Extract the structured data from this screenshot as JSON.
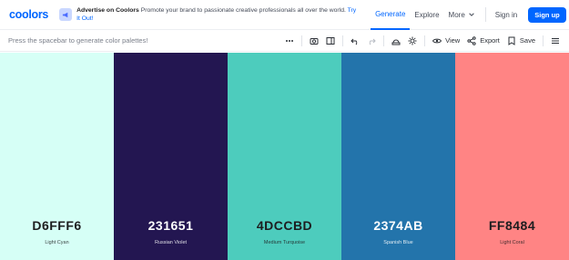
{
  "header": {
    "logo": "coolors",
    "ad": {
      "title": "Advertise on Coolors",
      "text": "Promote your brand to passionate creative professionals all over the world.",
      "cta": "Try It Out!"
    },
    "nav": [
      {
        "label": "Generate",
        "active": true
      },
      {
        "label": "Explore"
      },
      {
        "label": "More"
      }
    ],
    "signin": "Sign in",
    "signup": "Sign up"
  },
  "toolbar": {
    "hint": "Press the spacebar to generate color palettes!",
    "view_label": "View",
    "export_label": "Export",
    "save_label": "Save",
    "icons": [
      "more-icon",
      "camera-icon",
      "layout-icon",
      "undo-icon",
      "redo-icon",
      "accessibility-icon",
      "adjust-icon",
      "eye-icon",
      "share-icon",
      "bookmark-icon",
      "menu-icon"
    ]
  },
  "palette": [
    {
      "hex": "D6FFF6",
      "name": "Light Cyan",
      "color": "#D6FFF6",
      "text": "dark"
    },
    {
      "hex": "231651",
      "name": "Russian Violet",
      "color": "#231651",
      "text": "light"
    },
    {
      "hex": "4DCCBD",
      "name": "Medium Turquoise",
      "color": "#4DCCBD",
      "text": "dark"
    },
    {
      "hex": "2374AB",
      "name": "Spanish Blue",
      "color": "#2374AB",
      "text": "light"
    },
    {
      "hex": "FF8484",
      "name": "Light Coral",
      "color": "#FF8484",
      "text": "dark"
    }
  ]
}
